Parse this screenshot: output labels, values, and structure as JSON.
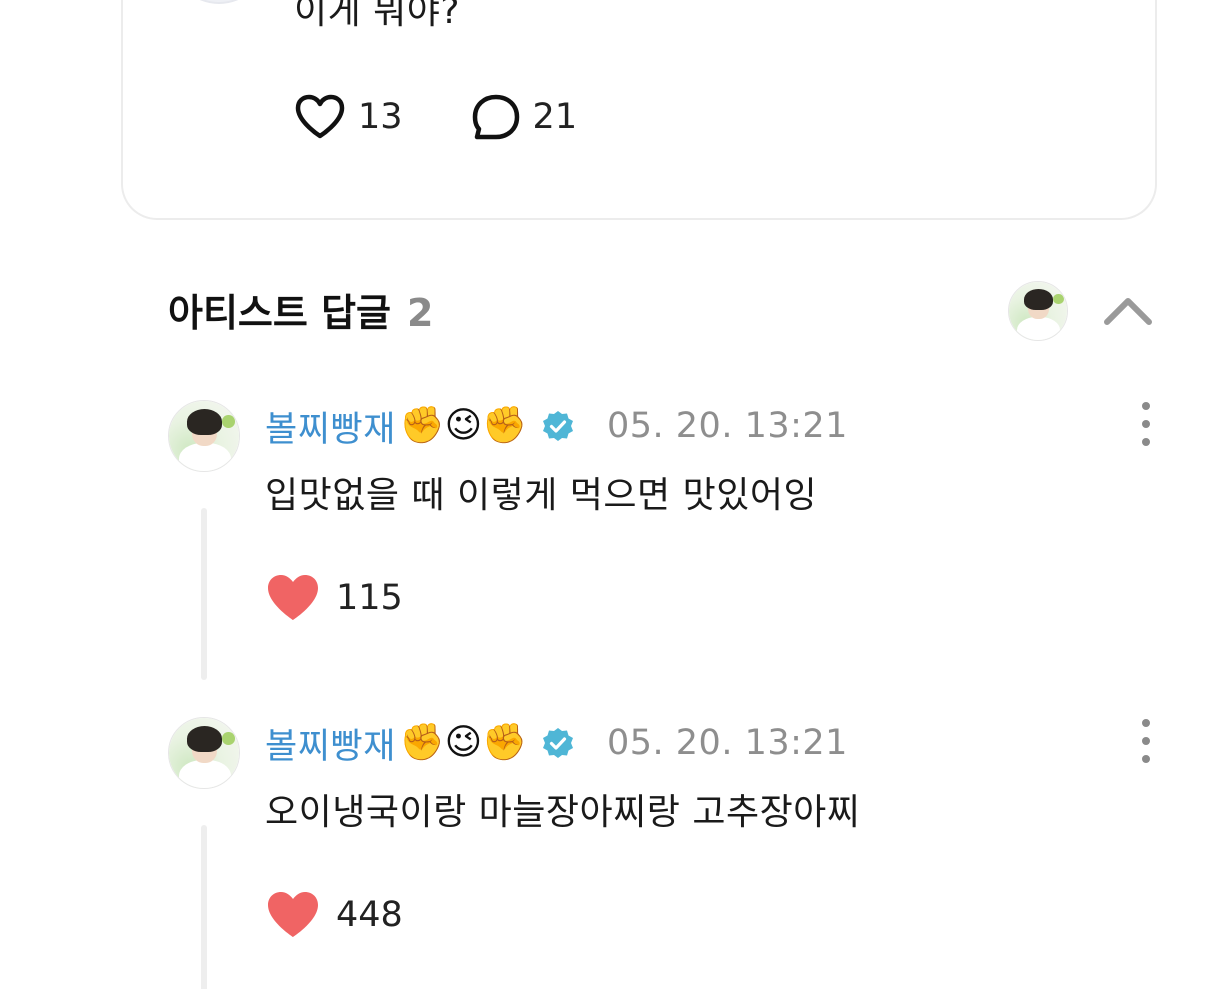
{
  "post": {
    "text": "이게 뭐야?",
    "likes": "13",
    "comments": "21"
  },
  "replies_section": {
    "title": "아티스트 답글",
    "count": "2"
  },
  "replies": [
    {
      "author": "볼찌빵재",
      "author_emoji": "✊😉✊",
      "verified": true,
      "time": "05. 20. 13:21",
      "text": "입맛없을 때 이렇게 먹으면 맛있어잉",
      "likes": "115",
      "liked": true
    },
    {
      "author": "볼찌빵재",
      "author_emoji": "✊😉✊",
      "verified": true,
      "time": "05. 20. 13:21",
      "text": "오이냉국이랑 마늘장아찌랑 고추장아찌",
      "likes": "448",
      "liked": true
    }
  ],
  "colors": {
    "author": "#3e8fcf",
    "verified_badge": "#4fb6d6",
    "liked_heart": "#f06464",
    "muted": "#8e8e8e"
  }
}
